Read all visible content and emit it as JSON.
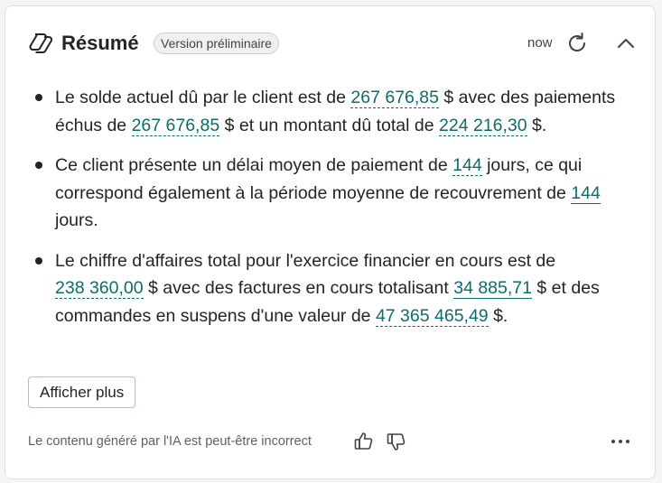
{
  "header": {
    "title": "Résumé",
    "badge": "Version préliminaire",
    "timestamp": "now"
  },
  "bullets": [
    {
      "t1": "Le solde actuel dû par le client est de ",
      "v1": "267 676,85",
      "t2": " $ avec des paiements échus de ",
      "v2": "267 676,85",
      "t3": " $ et un montant dû total de ",
      "v3": "224 216,30",
      "t4": " $."
    },
    {
      "t1": "Ce client présente un délai moyen de paiement de ",
      "v1": "144",
      "t2": " jours, ce qui correspond également à la période moyenne de recouvrement de ",
      "v2": "144",
      "t3": " jours."
    },
    {
      "t1": "Le chiffre d'affaires total pour l'exercice financier en cours est de ",
      "v1": "238 360,00",
      "t2": " $ avec des factures en cours totalisant ",
      "v2": "34 885,71",
      "t3": " $ et des commandes en suspens d'une valeur de ",
      "v3": "47 365 465,49",
      "t4": " $."
    }
  ],
  "actions": {
    "show_more": "Afficher plus"
  },
  "footer": {
    "disclaimer": "Le contenu généré par l'IA est peut-être incorrect"
  },
  "colors": {
    "accent": "#0f6b6b",
    "text": "#242424",
    "muted": "#616161"
  }
}
